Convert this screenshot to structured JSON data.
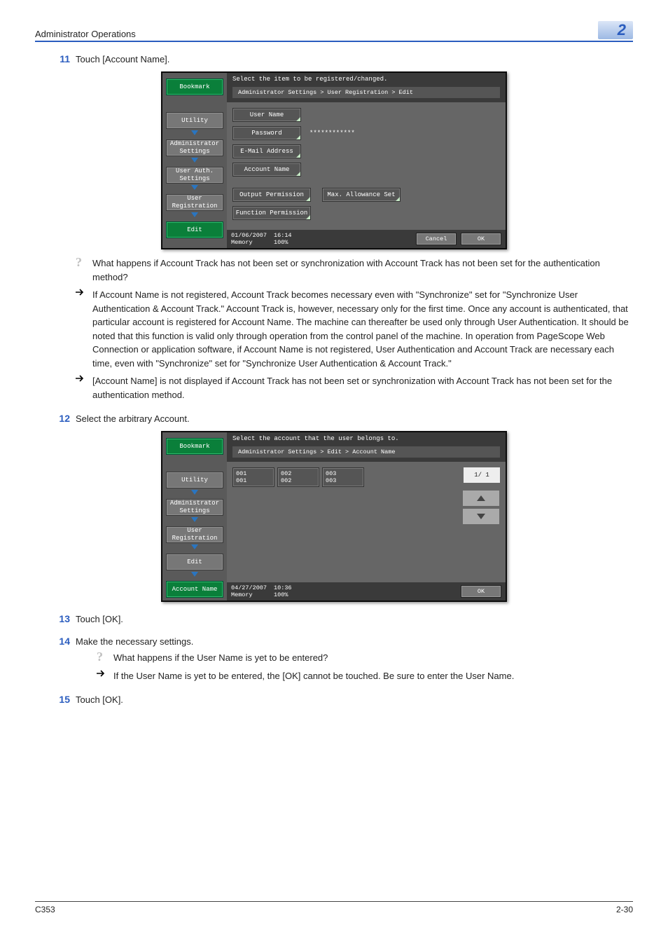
{
  "header": {
    "title": "Administrator Operations",
    "chapter": "2"
  },
  "steps": {
    "s11": {
      "num": "11",
      "text": "Touch [Account Name]."
    },
    "s12": {
      "num": "12",
      "text": "Select the arbitrary Account."
    },
    "s13": {
      "num": "13",
      "text": "Touch [OK]."
    },
    "s14": {
      "num": "14",
      "text": "Make the necessary settings."
    },
    "s15": {
      "num": "15",
      "text": "Touch [OK]."
    }
  },
  "qa": {
    "q1": "What happens if Account Track has not been set or synchronization with Account Track has not been set for the authentication method?",
    "a1": "If Account Name is not registered, Account Track becomes necessary even with \"Synchronize\" set for \"Synchronize User Authentication & Account Track.\" Account Track is, however, necessary only for the first time. Once any account is authenticated, that particular account is registered for Account Name. The machine can thereafter be used only through User Authentication. It should be noted that this function is valid only through operation from the control panel of the machine. In operation from PageScope Web Connection or application software, if Account Name is not registered, User Authentication and Account Track are necessary each time, even with \"Synchronize\" set for \"Synchronize User Authentication & Account Track.\"",
    "a2": "[Account Name] is not displayed if Account Track has not been set or synchronization with Account Track has not been set for the authentication method.",
    "q14": "What happens if the User Name is yet to be entered?",
    "a14": "If the User Name is yet to be entered, the [OK] cannot be touched. Be sure to enter the User Name."
  },
  "panel1": {
    "top": "Select the item to be registered/changed.",
    "bc": "Administrator Settings > User Registration > Edit",
    "side": {
      "bookmark": "Bookmark",
      "utility": "Utility",
      "admin": "Administrator Settings",
      "uauth": "User Auth. Settings",
      "ureg": "User Registration",
      "edit": "Edit"
    },
    "fields": {
      "uname": "User Name",
      "pwd": "Password",
      "pwd_val": "************",
      "email": "E-Mail Address",
      "acct": "Account Name",
      "outp": "Output Permission",
      "maxa": "Max. Allowance Set",
      "funcp": "Function Permission"
    },
    "footer": {
      "date": "01/06/2007",
      "time": "16:14",
      "mem": "Memory",
      "pct": "100%",
      "cancel": "Cancel",
      "ok": "OK"
    }
  },
  "panel2": {
    "top": "Select the account that the user belongs to.",
    "bc": "Administrator Settings > Edit > Account Name",
    "side": {
      "bookmark": "Bookmark",
      "utility": "Utility",
      "admin": "Administrator Settings",
      "ureg": "User Registration",
      "edit": "Edit",
      "acct": "Account Name"
    },
    "accounts": [
      {
        "n": "001",
        "name": "001"
      },
      {
        "n": "002",
        "name": "002"
      },
      {
        "n": "003",
        "name": "003"
      }
    ],
    "page": "1/ 1",
    "footer": {
      "date": "04/27/2007",
      "time": "10:36",
      "mem": "Memory",
      "pct": "100%",
      "ok": "OK"
    }
  },
  "footer": {
    "left": "C353",
    "right": "2-30"
  }
}
